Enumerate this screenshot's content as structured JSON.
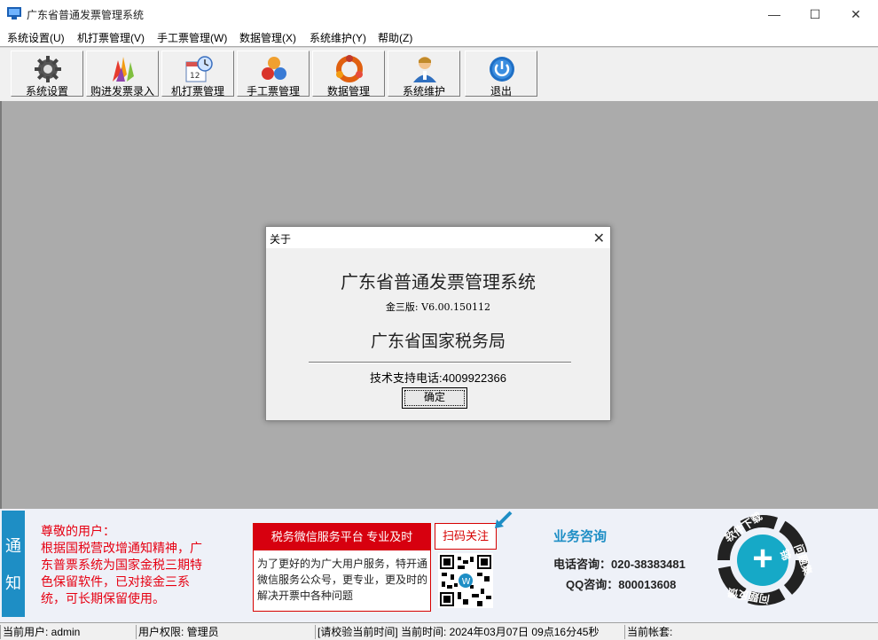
{
  "window": {
    "title": "广东省普通发票管理系统",
    "min_symbol": "—",
    "max_symbol": "☐",
    "close_symbol": "✕"
  },
  "menu": [
    "系统设置(U)",
    "机打票管理(V)",
    "手工票管理(W)",
    "数据管理(X)",
    "系统维护(Y)",
    "帮助(Z)"
  ],
  "toolbar": {
    "buttons": [
      {
        "label": "系统设置",
        "icon": "gear-icon"
      },
      {
        "label": "购进发票录入",
        "icon": "hands-icon"
      },
      {
        "label": "机打票管理",
        "icon": "calendar-clock-icon"
      },
      {
        "label": "手工票管理",
        "icon": "colored-balls-icon"
      },
      {
        "label": "数据管理",
        "icon": "data-ring-icon"
      },
      {
        "label": "系统维护",
        "icon": "user-service-icon"
      },
      {
        "label": "退出",
        "icon": "power-icon"
      }
    ]
  },
  "dialog": {
    "title": "关于",
    "close": "✕",
    "app_name": "广东省普通发票管理系统",
    "version": "金三版: V6.00.150112",
    "org": "广东省国家税务局",
    "support": "技术支持电话:4009922366",
    "ok": "确定"
  },
  "notice": {
    "tab": [
      "通",
      "知"
    ],
    "greeting": "尊敬的用户：",
    "body": "根据国税营改增通知精神，广东普票系统为国家金税三期特色保留软件，已对接金三系统，可长期保留使用。",
    "wechat_title": "税务微信服务平台  专业及时",
    "wechat_desc": "为了更好的为广大用户服务，特开通微信服务公众号，更专业，更及时的解决开票中各种问题",
    "scan_label": "扫码关注",
    "biz_title": "业务咨询",
    "phone": "电话咨询：020-38383481",
    "qq": "QQ咨询：800013608",
    "circle_labels": [
      "软件下载",
      "问题集锦",
      "问题反馈"
    ],
    "plus": "+"
  },
  "status": {
    "user": "当前用户:   admin",
    "role": "用户权限:  管理员",
    "time": "[请校验当前时间]  当前时间:  2024年03月07日  09点16分45秒",
    "account": "当前帐套:"
  },
  "colors": {
    "accent_blue": "#1e8ec5",
    "notice_red": "#e60012",
    "wechat_red": "#d7000f"
  }
}
